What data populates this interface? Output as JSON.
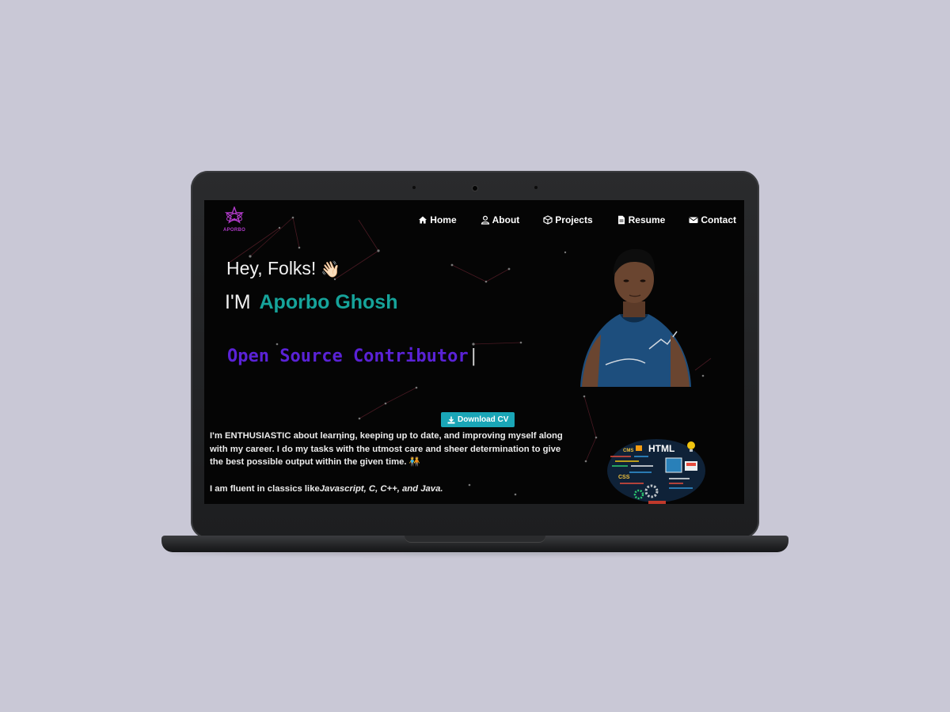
{
  "logo": {
    "text": "APORBO",
    "icon": "atom-star-logo-icon"
  },
  "nav": [
    {
      "label": "Home",
      "icon": "home-icon"
    },
    {
      "label": "About",
      "icon": "user-icon"
    },
    {
      "label": "Projects",
      "icon": "cube-icon"
    },
    {
      "label": "Resume",
      "icon": "document-icon"
    },
    {
      "label": "Contact",
      "icon": "envelope-icon"
    }
  ],
  "hero": {
    "greeting": "Hey, Folks!",
    "wave": "👋🏻",
    "intro_prefix": "I'M",
    "name": "Aporbo Ghosh",
    "role": "Open Source Contributor",
    "cursor": "|"
  },
  "download_button": {
    "label": "Download CV",
    "icon": "download-icon"
  },
  "about": {
    "paragraph": "I'm ENTHUSIASTIC about learning, keeping up to date, and improving myself along with my career. I do my tasks with the utmost care and sheer determination to give the best possible output within the given time. 🧑‍🤝‍🧑",
    "fluent_prefix": "I am fluent in classics like",
    "fluent_languages": "Javascript, C, C++, and Java."
  },
  "illustration": {
    "labels": [
      "HTML",
      "CSS",
      "CMS"
    ]
  },
  "colors": {
    "accent_name": "#16a39a",
    "role_color": "#5a22d6",
    "button_color": "#1aa6b7",
    "logo_color": "#b03ac9",
    "page_background": "#c9c8d6"
  }
}
